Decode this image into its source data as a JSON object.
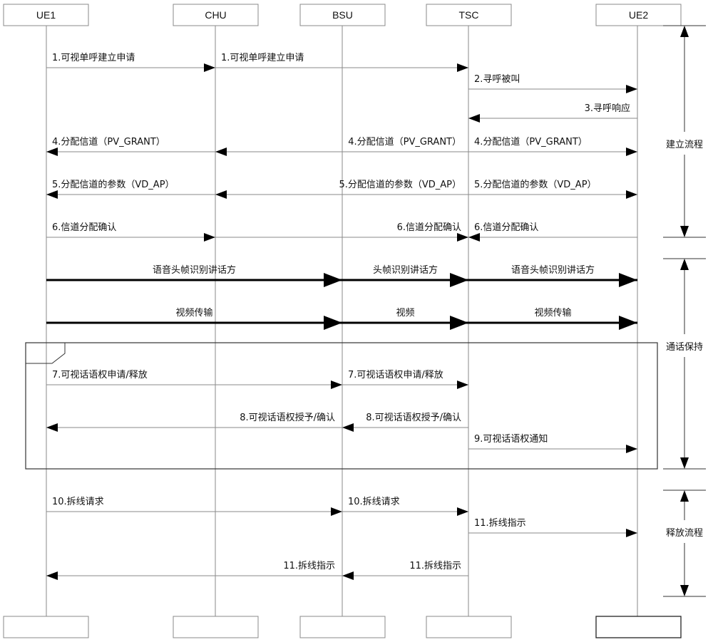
{
  "participants": [
    {
      "id": "UE1",
      "label": "UE1"
    },
    {
      "id": "CHU",
      "label": "CHU"
    },
    {
      "id": "BSU",
      "label": "BSU"
    },
    {
      "id": "TSC",
      "label": "TSC"
    },
    {
      "id": "UE2",
      "label": "UE2"
    }
  ],
  "messages": [
    {
      "from": "UE1",
      "to": "CHU",
      "label": "1.可视单呼建立申请",
      "style": "thin"
    },
    {
      "from": "CHU",
      "to": "TSC",
      "label": "1.可视单呼建立申请",
      "style": "thin"
    },
    {
      "from": "TSC",
      "to": "UE2",
      "label": "2.寻呼被叫",
      "style": "thin"
    },
    {
      "from": "UE2",
      "to": "TSC",
      "label": "3.寻呼响应",
      "style": "thin"
    },
    {
      "from": "CHU",
      "to": "UE1",
      "label": "4.分配信道（PV_GRANT）",
      "style": "thin"
    },
    {
      "from": "TSC",
      "to": "CHU",
      "label": "4.分配信道（PV_GRANT）",
      "style": "thin"
    },
    {
      "from": "TSC",
      "to": "UE2",
      "label": "4.分配信道（PV_GRANT）",
      "style": "thin"
    },
    {
      "from": "CHU",
      "to": "UE1",
      "label": "5.分配信道的参数（VD_AP）",
      "style": "thin"
    },
    {
      "from": "TSC",
      "to": "CHU",
      "label": "5.分配信道的参数（VD_AP）",
      "style": "thin"
    },
    {
      "from": "TSC",
      "to": "UE2",
      "label": "5.分配信道的参数（VD_AP）",
      "style": "thin"
    },
    {
      "from": "UE1",
      "to": "CHU",
      "label": "6.信道分配确认",
      "style": "thin"
    },
    {
      "from": "CHU",
      "to": "TSC",
      "label": "6.信道分配确认",
      "style": "thin"
    },
    {
      "from": "UE2",
      "to": "TSC",
      "label": "6.信道分配确认",
      "style": "thin"
    },
    {
      "from": "UE1",
      "to": "BSU",
      "label": "语音头帧识别讲话方",
      "style": "thick"
    },
    {
      "from": "BSU",
      "to": "TSC",
      "label": "头帧识别讲话方",
      "style": "thick"
    },
    {
      "from": "TSC",
      "to": "UE2",
      "label": "语音头帧识别讲话方",
      "style": "thick"
    },
    {
      "from": "UE1",
      "to": "BSU",
      "label": "视频传输",
      "style": "thick"
    },
    {
      "from": "BSU",
      "to": "TSC",
      "label": "视频",
      "style": "thick"
    },
    {
      "from": "TSC",
      "to": "UE2",
      "label": "视频传输",
      "style": "thick"
    },
    {
      "from": "UE1",
      "to": "BSU",
      "label": "7.可视话语权申请/释放",
      "style": "thin"
    },
    {
      "from": "BSU",
      "to": "TSC",
      "label": "7.可视话语权申请/释放",
      "style": "thin"
    },
    {
      "from": "BSU",
      "to": "UE1",
      "label": "8.可视话语权授予/确认",
      "style": "thin"
    },
    {
      "from": "TSC",
      "to": "BSU",
      "label": "8.可视话语权授予/确认",
      "style": "thin"
    },
    {
      "from": "TSC",
      "to": "UE2",
      "label": "9.可视话语权通知",
      "style": "thin"
    },
    {
      "from": "UE1",
      "to": "BSU",
      "label": "10.拆线请求",
      "style": "thin"
    },
    {
      "from": "BSU",
      "to": "TSC",
      "label": "10.拆线请求",
      "style": "thin"
    },
    {
      "from": "TSC",
      "to": "UE2",
      "label": "11.拆线指示",
      "style": "thin"
    },
    {
      "from": "BSU",
      "to": "UE1",
      "label": "11.拆线指示",
      "style": "thin"
    },
    {
      "from": "TSC",
      "to": "BSU",
      "label": "11.拆线指示",
      "style": "thin"
    }
  ],
  "phases": [
    {
      "label": "建立流程"
    },
    {
      "label": "通话保持"
    },
    {
      "label": "释放流程"
    }
  ],
  "colors": {
    "line": "#8a8a8a",
    "arrow": "#000000",
    "frame": "#333333"
  }
}
